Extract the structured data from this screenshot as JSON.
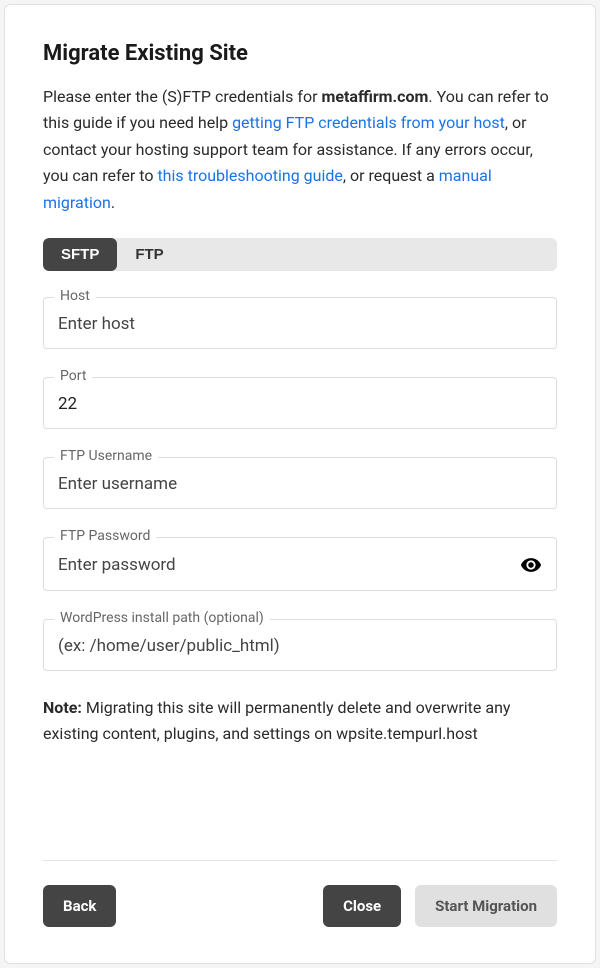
{
  "title": "Migrate Existing Site",
  "intro": {
    "pre": "Please enter the (S)FTP credentials for ",
    "domain": "metaffirm.com",
    "post_domain": ". You can refer to this guide if you need help ",
    "link1": "getting FTP credentials from your host",
    "mid1": ", or contact your hosting support team for assistance. If any errors occur, you can refer to ",
    "link2": "this troubleshooting guide",
    "mid2": ", or request a ",
    "link3": "manual migration",
    "tail": "."
  },
  "tabs": {
    "sftp": "SFTP",
    "ftp": "FTP"
  },
  "fields": {
    "host": {
      "label": "Host",
      "placeholder": "Enter host",
      "value": ""
    },
    "port": {
      "label": "Port",
      "placeholder": "",
      "value": "22"
    },
    "username": {
      "label": "FTP Username",
      "placeholder": "Enter username",
      "value": ""
    },
    "password": {
      "label": "FTP Password",
      "placeholder": "Enter password",
      "value": ""
    },
    "path": {
      "label": "WordPress install path (optional)",
      "placeholder": "(ex: /home/user/public_html)",
      "value": ""
    }
  },
  "note": {
    "label": "Note:",
    "text": " Migrating this site will permanently delete and overwrite any existing content, plugins, and settings on wpsite.tempurl.host"
  },
  "buttons": {
    "back": "Back",
    "close": "Close",
    "start": "Start Migration"
  }
}
